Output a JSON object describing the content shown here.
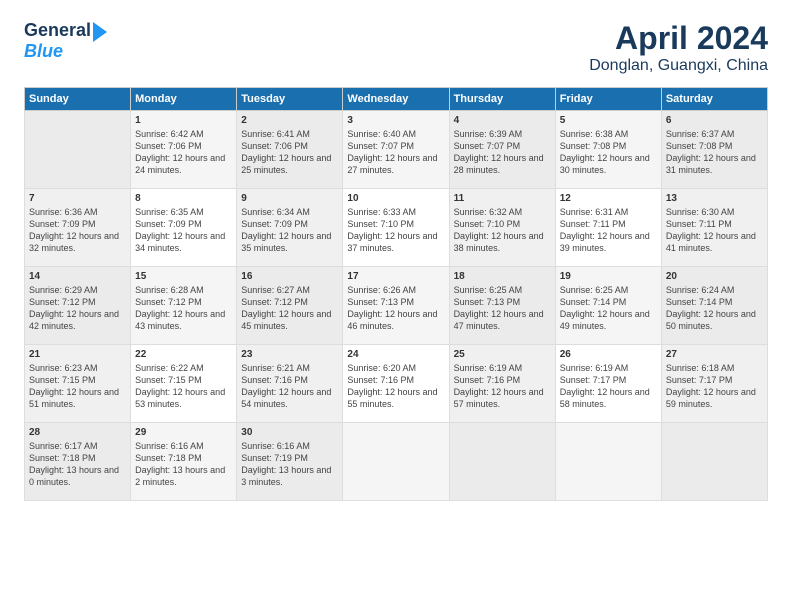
{
  "header": {
    "logo_line1": "General",
    "logo_line2": "Blue",
    "month": "April 2024",
    "location": "Donglan, Guangxi, China"
  },
  "days_of_week": [
    "Sunday",
    "Monday",
    "Tuesday",
    "Wednesday",
    "Thursday",
    "Friday",
    "Saturday"
  ],
  "weeks": [
    [
      {
        "day": "",
        "sunrise": "",
        "sunset": "",
        "daylight": ""
      },
      {
        "day": "1",
        "sunrise": "Sunrise: 6:42 AM",
        "sunset": "Sunset: 7:06 PM",
        "daylight": "Daylight: 12 hours and 24 minutes."
      },
      {
        "day": "2",
        "sunrise": "Sunrise: 6:41 AM",
        "sunset": "Sunset: 7:06 PM",
        "daylight": "Daylight: 12 hours and 25 minutes."
      },
      {
        "day": "3",
        "sunrise": "Sunrise: 6:40 AM",
        "sunset": "Sunset: 7:07 PM",
        "daylight": "Daylight: 12 hours and 27 minutes."
      },
      {
        "day": "4",
        "sunrise": "Sunrise: 6:39 AM",
        "sunset": "Sunset: 7:07 PM",
        "daylight": "Daylight: 12 hours and 28 minutes."
      },
      {
        "day": "5",
        "sunrise": "Sunrise: 6:38 AM",
        "sunset": "Sunset: 7:08 PM",
        "daylight": "Daylight: 12 hours and 30 minutes."
      },
      {
        "day": "6",
        "sunrise": "Sunrise: 6:37 AM",
        "sunset": "Sunset: 7:08 PM",
        "daylight": "Daylight: 12 hours and 31 minutes."
      }
    ],
    [
      {
        "day": "7",
        "sunrise": "Sunrise: 6:36 AM",
        "sunset": "Sunset: 7:09 PM",
        "daylight": "Daylight: 12 hours and 32 minutes."
      },
      {
        "day": "8",
        "sunrise": "Sunrise: 6:35 AM",
        "sunset": "Sunset: 7:09 PM",
        "daylight": "Daylight: 12 hours and 34 minutes."
      },
      {
        "day": "9",
        "sunrise": "Sunrise: 6:34 AM",
        "sunset": "Sunset: 7:09 PM",
        "daylight": "Daylight: 12 hours and 35 minutes."
      },
      {
        "day": "10",
        "sunrise": "Sunrise: 6:33 AM",
        "sunset": "Sunset: 7:10 PM",
        "daylight": "Daylight: 12 hours and 37 minutes."
      },
      {
        "day": "11",
        "sunrise": "Sunrise: 6:32 AM",
        "sunset": "Sunset: 7:10 PM",
        "daylight": "Daylight: 12 hours and 38 minutes."
      },
      {
        "day": "12",
        "sunrise": "Sunrise: 6:31 AM",
        "sunset": "Sunset: 7:11 PM",
        "daylight": "Daylight: 12 hours and 39 minutes."
      },
      {
        "day": "13",
        "sunrise": "Sunrise: 6:30 AM",
        "sunset": "Sunset: 7:11 PM",
        "daylight": "Daylight: 12 hours and 41 minutes."
      }
    ],
    [
      {
        "day": "14",
        "sunrise": "Sunrise: 6:29 AM",
        "sunset": "Sunset: 7:12 PM",
        "daylight": "Daylight: 12 hours and 42 minutes."
      },
      {
        "day": "15",
        "sunrise": "Sunrise: 6:28 AM",
        "sunset": "Sunset: 7:12 PM",
        "daylight": "Daylight: 12 hours and 43 minutes."
      },
      {
        "day": "16",
        "sunrise": "Sunrise: 6:27 AM",
        "sunset": "Sunset: 7:12 PM",
        "daylight": "Daylight: 12 hours and 45 minutes."
      },
      {
        "day": "17",
        "sunrise": "Sunrise: 6:26 AM",
        "sunset": "Sunset: 7:13 PM",
        "daylight": "Daylight: 12 hours and 46 minutes."
      },
      {
        "day": "18",
        "sunrise": "Sunrise: 6:25 AM",
        "sunset": "Sunset: 7:13 PM",
        "daylight": "Daylight: 12 hours and 47 minutes."
      },
      {
        "day": "19",
        "sunrise": "Sunrise: 6:25 AM",
        "sunset": "Sunset: 7:14 PM",
        "daylight": "Daylight: 12 hours and 49 minutes."
      },
      {
        "day": "20",
        "sunrise": "Sunrise: 6:24 AM",
        "sunset": "Sunset: 7:14 PM",
        "daylight": "Daylight: 12 hours and 50 minutes."
      }
    ],
    [
      {
        "day": "21",
        "sunrise": "Sunrise: 6:23 AM",
        "sunset": "Sunset: 7:15 PM",
        "daylight": "Daylight: 12 hours and 51 minutes."
      },
      {
        "day": "22",
        "sunrise": "Sunrise: 6:22 AM",
        "sunset": "Sunset: 7:15 PM",
        "daylight": "Daylight: 12 hours and 53 minutes."
      },
      {
        "day": "23",
        "sunrise": "Sunrise: 6:21 AM",
        "sunset": "Sunset: 7:16 PM",
        "daylight": "Daylight: 12 hours and 54 minutes."
      },
      {
        "day": "24",
        "sunrise": "Sunrise: 6:20 AM",
        "sunset": "Sunset: 7:16 PM",
        "daylight": "Daylight: 12 hours and 55 minutes."
      },
      {
        "day": "25",
        "sunrise": "Sunrise: 6:19 AM",
        "sunset": "Sunset: 7:16 PM",
        "daylight": "Daylight: 12 hours and 57 minutes."
      },
      {
        "day": "26",
        "sunrise": "Sunrise: 6:19 AM",
        "sunset": "Sunset: 7:17 PM",
        "daylight": "Daylight: 12 hours and 58 minutes."
      },
      {
        "day": "27",
        "sunrise": "Sunrise: 6:18 AM",
        "sunset": "Sunset: 7:17 PM",
        "daylight": "Daylight: 12 hours and 59 minutes."
      }
    ],
    [
      {
        "day": "28",
        "sunrise": "Sunrise: 6:17 AM",
        "sunset": "Sunset: 7:18 PM",
        "daylight": "Daylight: 13 hours and 0 minutes."
      },
      {
        "day": "29",
        "sunrise": "Sunrise: 6:16 AM",
        "sunset": "Sunset: 7:18 PM",
        "daylight": "Daylight: 13 hours and 2 minutes."
      },
      {
        "day": "30",
        "sunrise": "Sunrise: 6:16 AM",
        "sunset": "Sunset: 7:19 PM",
        "daylight": "Daylight: 13 hours and 3 minutes."
      },
      {
        "day": "",
        "sunrise": "",
        "sunset": "",
        "daylight": ""
      },
      {
        "day": "",
        "sunrise": "",
        "sunset": "",
        "daylight": ""
      },
      {
        "day": "",
        "sunrise": "",
        "sunset": "",
        "daylight": ""
      },
      {
        "day": "",
        "sunrise": "",
        "sunset": "",
        "daylight": ""
      }
    ]
  ]
}
